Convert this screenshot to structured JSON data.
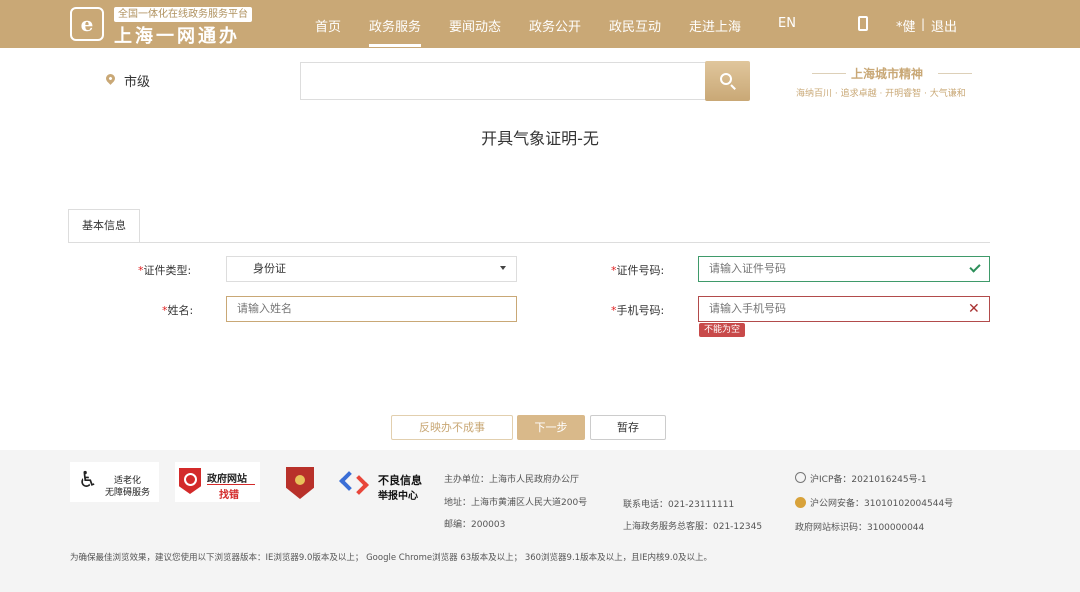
{
  "header": {
    "logo_subtitle": "全国一体化在线政务服务平台",
    "logo_title": "上海一网通办",
    "nav": [
      "首页",
      "政务服务",
      "要闻动态",
      "政务公开",
      "政民互动",
      "走进上海",
      "EN"
    ],
    "active_nav": "政务服务",
    "user": "*健",
    "separator": "|",
    "logout": "退出"
  },
  "search": {
    "location": "市级",
    "value": ""
  },
  "spirit": {
    "title": "上海城市精神",
    "subtitle": "海纳百川 · 追求卓越 · 开明睿智 · 大气谦和"
  },
  "page_title": "开具气象证明-无",
  "tabs": [
    "基本信息"
  ],
  "form": {
    "id_type": {
      "required_mark": "*",
      "label": "证件类型:",
      "value": "身份证"
    },
    "id_number": {
      "required_mark": "*",
      "label": "证件号码:",
      "placeholder": "请输入证件号码"
    },
    "name": {
      "required_mark": "*",
      "label": "姓名:",
      "placeholder": "请输入姓名"
    },
    "phone": {
      "required_mark": "*",
      "label": "手机号码:",
      "placeholder": "请输入手机号码",
      "error": "不能为空"
    }
  },
  "buttons": {
    "feedback": "反映办不成事",
    "next": "下一步",
    "save": "暂存"
  },
  "footer": {
    "accessibility_line1": "适老化",
    "accessibility_line2": "无障碍服务",
    "gov_site_line1": "政府网站",
    "gov_site_line2": "找错",
    "report_line1": "不良信息",
    "report_line2": "举报中心",
    "host": "主办单位：上海市人民政府办公厅",
    "address": "地址：上海市黄浦区人民大道200号",
    "postcode": "邮编：200003",
    "phone": "联系电话：021-23111111",
    "service_phone": "上海政务服务总客服：021-12345",
    "icp": "沪ICP备：2021016245号-1",
    "police": "沪公网安备：31010102004544号",
    "site_id": "政府网站标识码：3100000044",
    "browser_note": "为确保最佳浏览效果，建议您使用以下浏览器版本：IE浏览器9.0版本及以上；  Google Chrome浏览器 63版本及以上；  360浏览器9.1版本及以上，且IE内核9.0及以上。"
  },
  "colors": {
    "brand": "#c9a876",
    "valid": "#3f9a6a",
    "error": "#c84a4a"
  }
}
